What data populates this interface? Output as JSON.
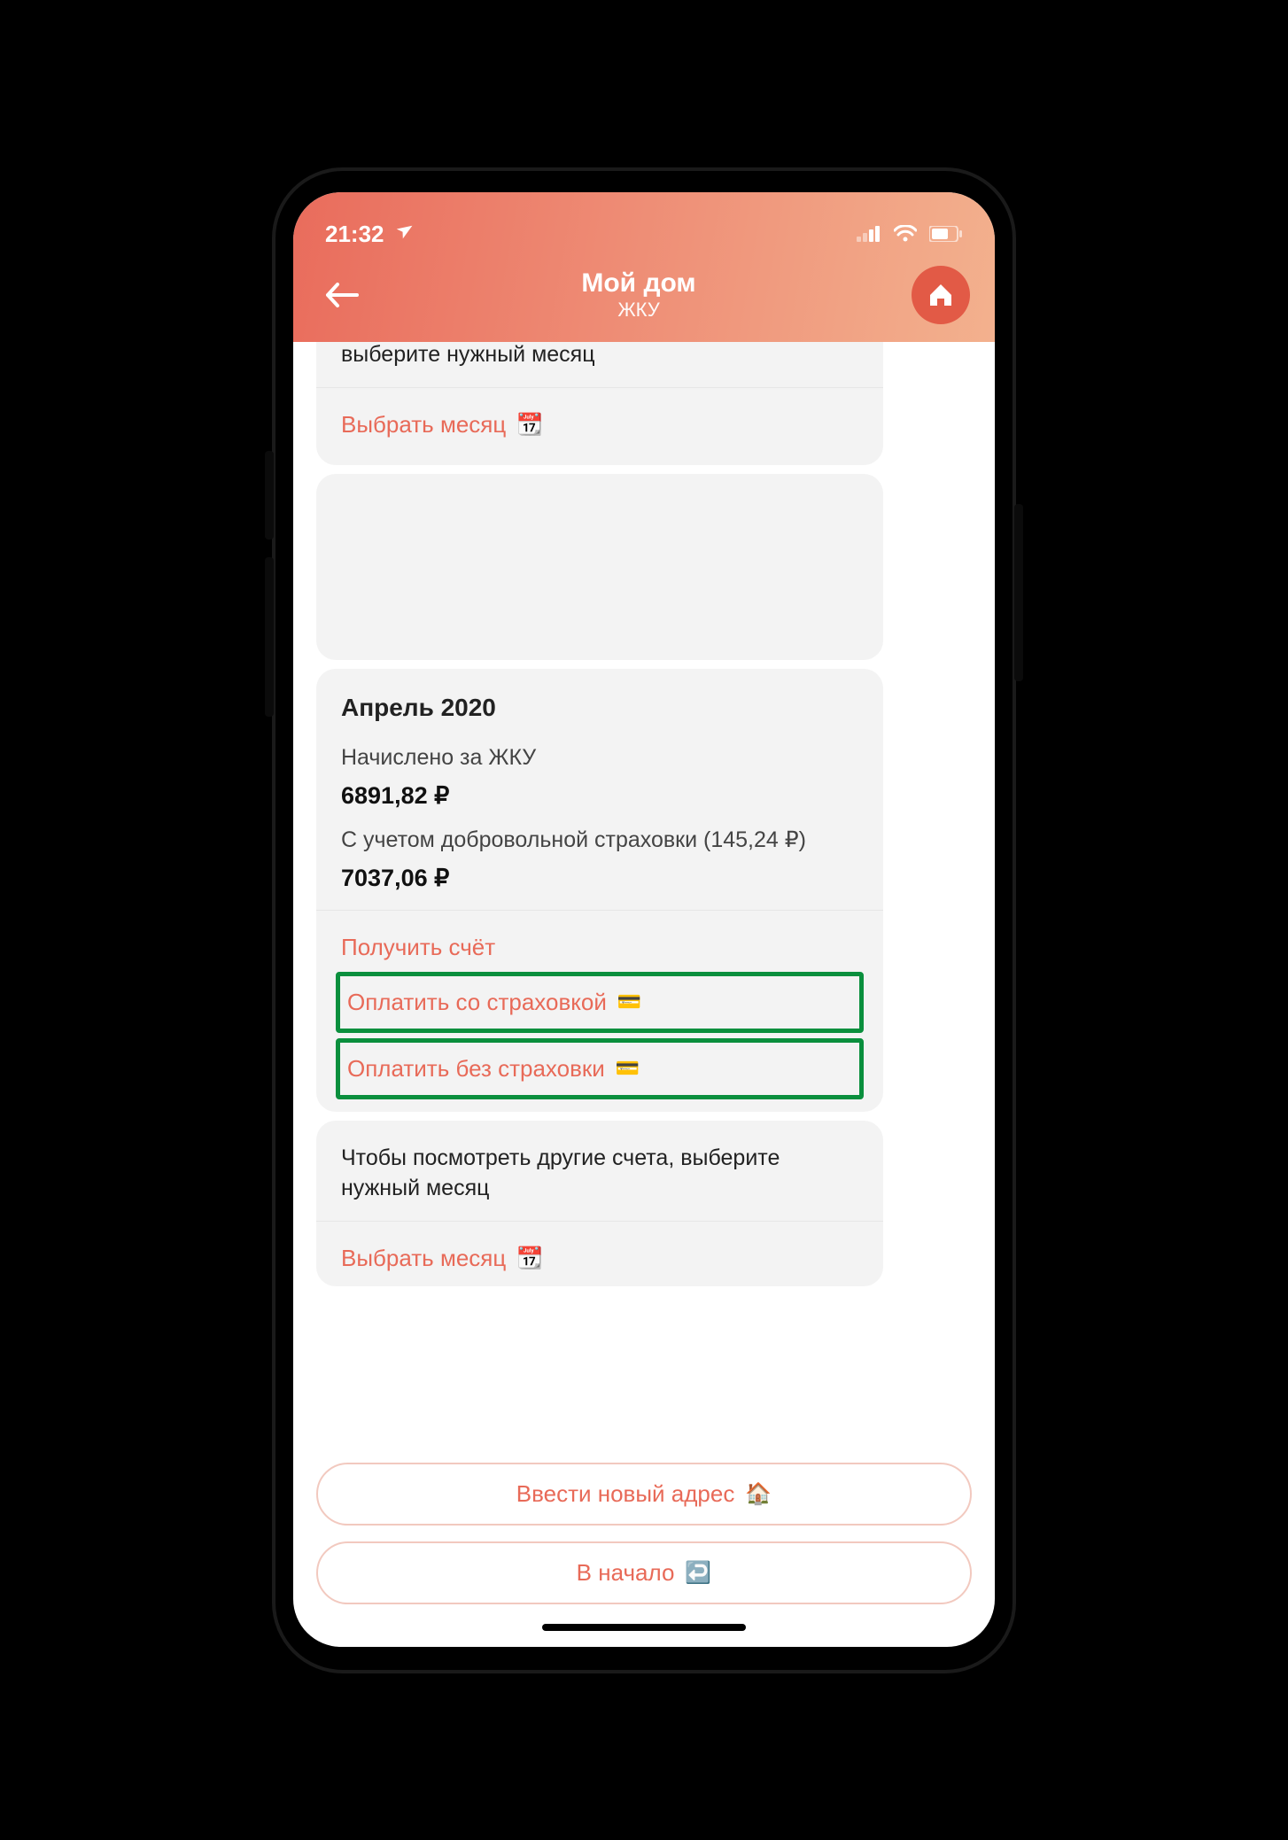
{
  "status": {
    "time": "21:32",
    "location_icon": "location-arrow-icon"
  },
  "header": {
    "title": "Мой дом",
    "subtitle": "ЖКУ"
  },
  "chat": {
    "top_tip_tail": "выберите нужный месяц",
    "select_month_label": "Выбрать месяц",
    "calendar_emoji": "📆",
    "bill": {
      "month_title": "Апрель 2020",
      "charged_label": "Начислено за ЖКУ",
      "charged_amount": "6891,82 ₽",
      "with_insurance_label": "С учетом добровольной страховки (145,24 ₽)",
      "total_amount": "7037,06 ₽",
      "get_bill_label": "Получить счёт",
      "pay_with_insurance": "Оплатить со страховкой",
      "pay_without_insurance": "Оплатить без страховки",
      "card_emoji": "💳"
    },
    "tip_text": "Чтобы посмотреть другие счета, выберите нужный месяц",
    "select_month_label_2": "Выбрать месяц"
  },
  "footer": {
    "new_address": "Ввести новый адрес",
    "house_emoji": "🏠",
    "to_start": "В начало",
    "back_emoji": "↩️"
  }
}
